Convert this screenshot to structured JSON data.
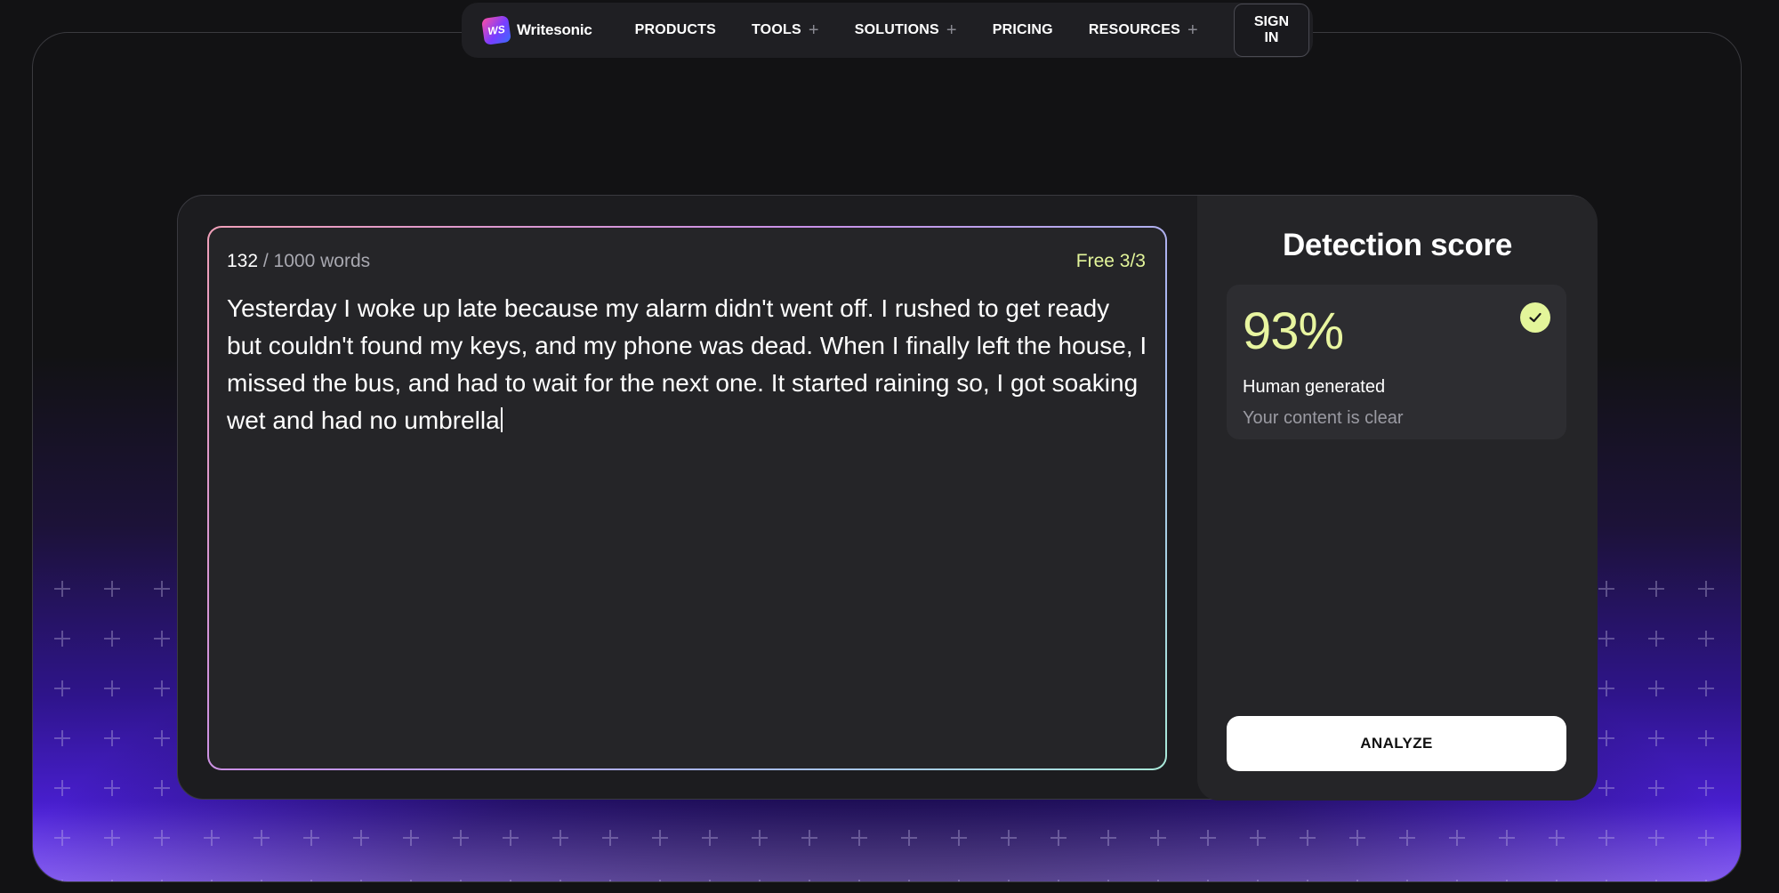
{
  "nav": {
    "brand": "Writesonic",
    "brand_mark": "WS",
    "items": [
      {
        "label": "PRODUCTS",
        "has_plus": false
      },
      {
        "label": "TOOLS",
        "has_plus": true
      },
      {
        "label": "SOLUTIONS",
        "has_plus": true
      },
      {
        "label": "PRICING",
        "has_plus": false
      },
      {
        "label": "RESOURCES",
        "has_plus": true
      }
    ],
    "signin_label": "SIGN IN"
  },
  "editor": {
    "word_count": "132",
    "word_limit": "/ 1000 words",
    "free_badge": "Free 3/3",
    "text": "Yesterday I woke up late because my alarm didn't went off. I rushed to get ready but couldn't found my keys, and my phone was dead. When I finally left the house, I missed the bus, and had to wait for the next one. It started raining so, I got soaking wet and had no umbrella"
  },
  "result": {
    "title": "Detection score",
    "score": "93%",
    "label": "Human generated",
    "sub": "Your content is clear",
    "analyze_label": "ANALYZE"
  },
  "colors": {
    "accent": "#e3f59a",
    "background": "#121214",
    "glow": "#4a1fd4"
  },
  "icons": [
    "plus-icon",
    "check-circle-icon",
    "writesonic-logo-icon"
  ]
}
